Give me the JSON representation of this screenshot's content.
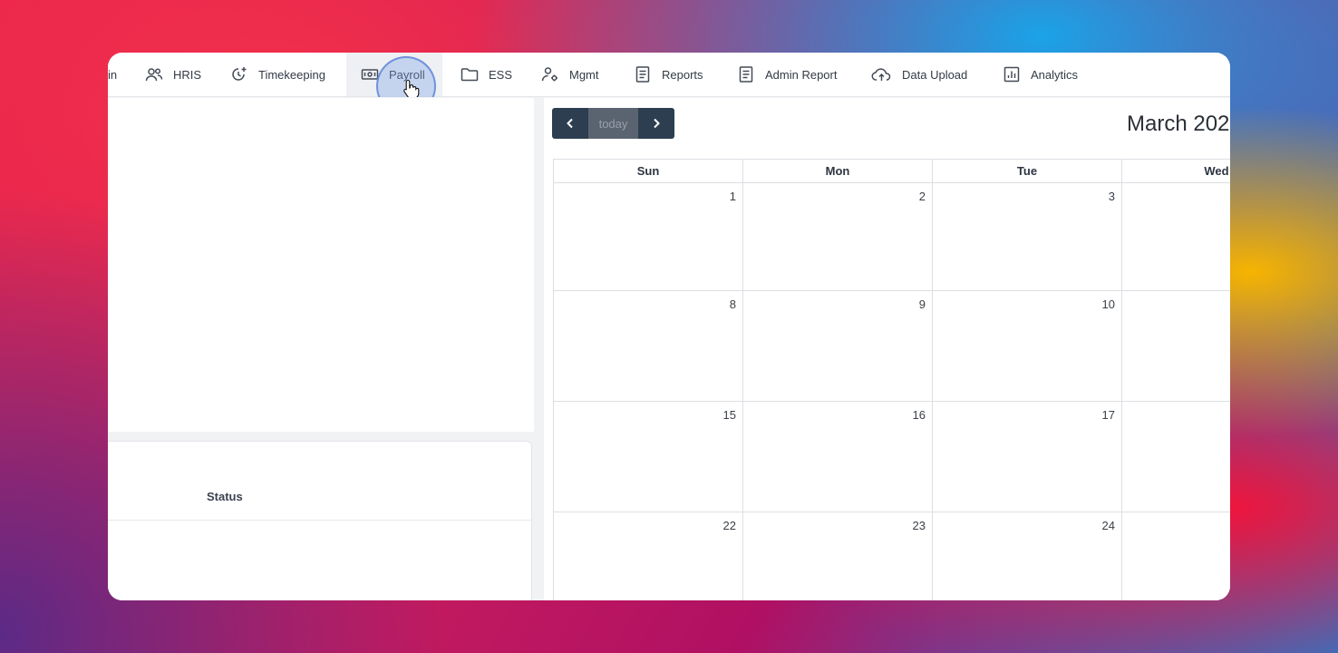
{
  "nav": {
    "items": [
      {
        "label": "in",
        "icon": "none"
      },
      {
        "label": "HRIS",
        "icon": "people-icon"
      },
      {
        "label": "Timekeeping",
        "icon": "clock-plus-icon"
      },
      {
        "label": "Payroll",
        "icon": "money-icon"
      },
      {
        "label": "ESS",
        "icon": "folder-icon"
      },
      {
        "label": "Mgmt",
        "icon": "user-gear-icon"
      },
      {
        "label": "Reports",
        "icon": "document-icon"
      },
      {
        "label": "Admin Report",
        "icon": "document-icon"
      },
      {
        "label": "Data Upload",
        "icon": "cloud-upload-icon"
      },
      {
        "label": "Analytics",
        "icon": "bar-chart-icon"
      }
    ],
    "active": "Payroll"
  },
  "table": {
    "status_header": "Status"
  },
  "calendar": {
    "title": "March 202",
    "today_label": "today",
    "prev_icon": "chevron-left-icon",
    "next_icon": "chevron-right-icon",
    "weekdays": [
      "Sun",
      "Mon",
      "Tue",
      "Wed"
    ],
    "weeks": [
      [
        "1",
        "2",
        "3",
        ""
      ],
      [
        "8",
        "9",
        "10",
        ""
      ],
      [
        "15",
        "16",
        "17",
        ""
      ],
      [
        "22",
        "23",
        "24",
        ""
      ]
    ]
  },
  "colors": {
    "calendar_button": "#2c3e50",
    "today_button": "#5a6470",
    "highlight": "#78a0e6"
  }
}
